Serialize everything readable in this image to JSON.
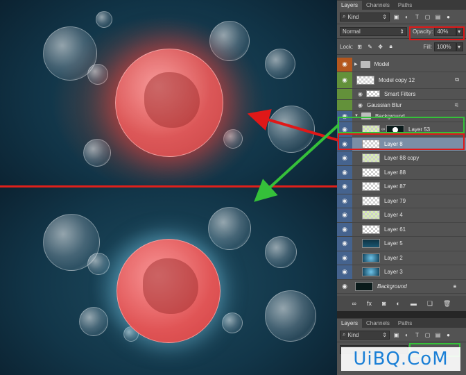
{
  "panel": {
    "tabs": [
      "Layers",
      "Channels",
      "Paths"
    ],
    "filter_kind": "Kind",
    "blend_mode": "Normal",
    "opacity_label": "Opacity:",
    "opacity_value": "40%",
    "lock_label": "Lock:",
    "fill_label": "Fill:",
    "fill_value": "100%"
  },
  "layers": [
    {
      "name": "Model",
      "type": "group"
    },
    {
      "name": "Model copy 12",
      "type": "smart"
    },
    {
      "name": "Smart Filters",
      "type": "filters"
    },
    {
      "name": "Gaussian Blur",
      "type": "filter"
    },
    {
      "name": "Background",
      "type": "group"
    },
    {
      "name": "Layer 53",
      "type": "masked"
    },
    {
      "name": "Layer 8",
      "type": "layer",
      "selected": true
    },
    {
      "name": "Layer 88 copy",
      "type": "layer"
    },
    {
      "name": "Layer 88",
      "type": "layer"
    },
    {
      "name": "Layer 87",
      "type": "layer"
    },
    {
      "name": "Layer 79",
      "type": "layer"
    },
    {
      "name": "Layer 4",
      "type": "layer"
    },
    {
      "name": "Layer 61",
      "type": "layer"
    },
    {
      "name": "Layer 5",
      "type": "layer"
    },
    {
      "name": "Layer 2",
      "type": "layer"
    },
    {
      "name": "Layer 3",
      "type": "layer"
    },
    {
      "name": "Background",
      "type": "background"
    }
  ],
  "lower_panel": {
    "tabs": [
      "Layers",
      "Channels",
      "Paths"
    ],
    "filter_kind": "Kind"
  },
  "watermark": "UiBQ.CoM",
  "colors": {
    "highlight_red": "#e01818",
    "highlight_green": "#35c03a",
    "selected_row": "#7b8ea6",
    "eye_blue": "#45638e",
    "eye_orange": "#b4571e",
    "eye_green": "#63913a"
  }
}
